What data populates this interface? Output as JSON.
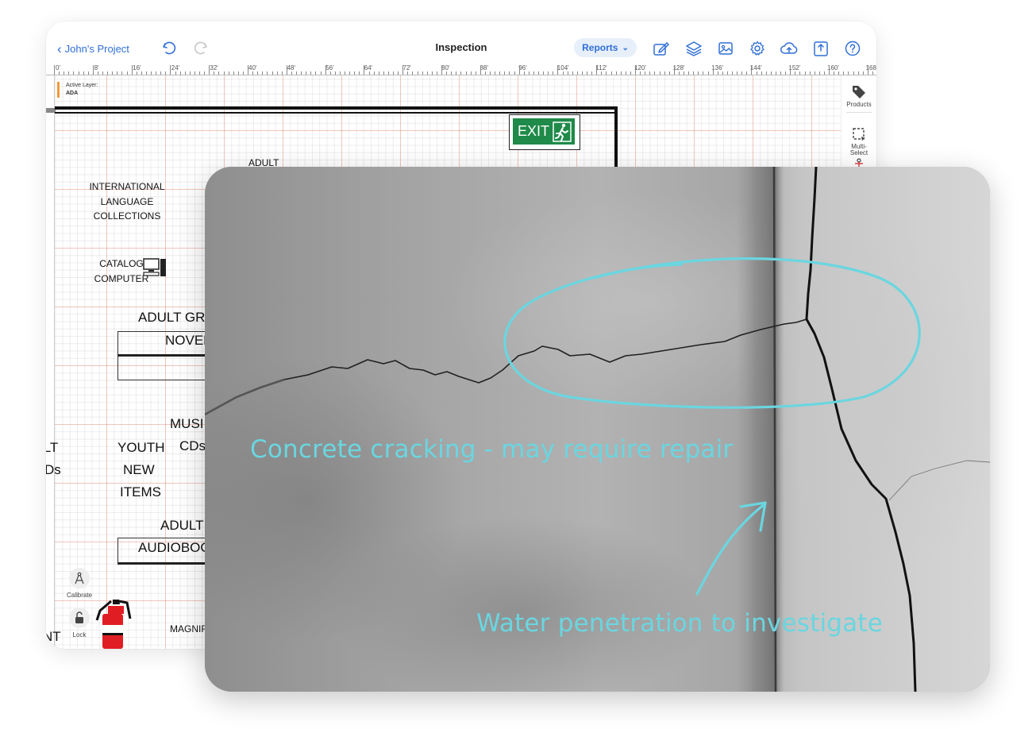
{
  "app": {
    "back_label": "John's Project",
    "title": "Inspection",
    "reports_label": "Reports",
    "active_layer_caption": "Active Layer:",
    "active_layer_name": "ADA",
    "ruler_labels": [
      "0'",
      "8'",
      "16'",
      "24'",
      "32'",
      "40'",
      "48'",
      "56'",
      "64'",
      "72'",
      "80'",
      "88'",
      "96'",
      "104'",
      "112'",
      "120'",
      "128'",
      "136'",
      "144'",
      "152'",
      "160'",
      "168'"
    ],
    "right_panel": {
      "products_label": "Products",
      "multiselect_label": "Multi-\nSelect"
    },
    "bottom_tools": {
      "calibrate_label": "Calibrate",
      "lock_label": "Lock"
    },
    "colors": {
      "accent": "#2f6fd6",
      "exit_green": "#1f8a49",
      "layer_orange": "#f29a3a"
    }
  },
  "floor_plan": {
    "exit_label": "EXIT",
    "labels": {
      "adult_top": "ADULT",
      "intl_1": "INTERNATIONAL",
      "intl_2": "LANGUAGE COLLECTIONS",
      "catalog_1": "CATALOG",
      "catalog_2": "COMPUTER",
      "adult_graphic": "ADULT GRA",
      "novel": "NOVEL",
      "music": "MUSI",
      "cds": "CDs",
      "ult": "ILT",
      "ds": "Ds",
      "youth": "YOUTH",
      "new": "NEW",
      "items": "ITEMS",
      "adult_mid": "ADULT",
      "audiobook": "AUDIOBOO",
      "magnif": "MAGNIF",
      "nt": "NT"
    }
  },
  "photo": {
    "annotation_crack": "Concrete cracking - may require repair",
    "annotation_water": "Water penetration to investigate",
    "annotation_color": "#6ad6e0"
  }
}
